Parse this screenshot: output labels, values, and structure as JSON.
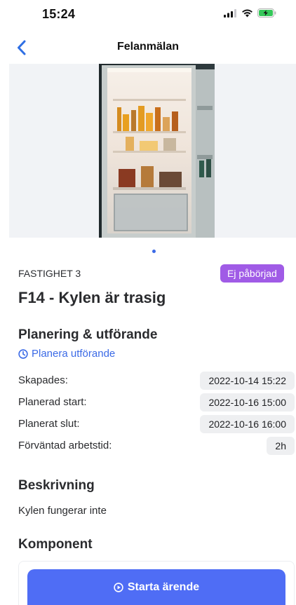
{
  "status_bar": {
    "time": "15:24"
  },
  "nav": {
    "title": "Felanmälan",
    "back_icon": "chevron-left-icon"
  },
  "gallery": {
    "page_count": 1,
    "active_page": 1
  },
  "task": {
    "property": "FASTIGHET 3",
    "status": "Ej påbörjad",
    "status_color": "#a05be6",
    "title": "F14 - Kylen är trasig"
  },
  "planning": {
    "heading": "Planering & utförande",
    "plan_link": "Planera utförande",
    "rows": [
      {
        "label": "Skapades:",
        "value": "2022-10-14 15:22"
      },
      {
        "label": "Planerad start:",
        "value": "2022-10-16 15:00"
      },
      {
        "label": "Planerat slut:",
        "value": "2022-10-16 16:00"
      },
      {
        "label": "Förväntad arbetstid:",
        "value": "2h"
      }
    ]
  },
  "description": {
    "heading": "Beskrivning",
    "text": "Kylen fungerar inte"
  },
  "component": {
    "heading": "Komponent"
  },
  "actions": {
    "start_label": "Starta ärende",
    "accent": "#4f6df5"
  }
}
